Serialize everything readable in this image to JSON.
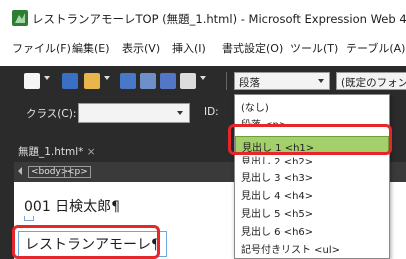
{
  "window": {
    "title": "レストランアモーレTOP (無題_1.html) - Microsoft Expression Web 4"
  },
  "menu": {
    "items": [
      "ファイル(F)",
      "編集(E)",
      "表示(V)",
      "挿入(I)",
      "書式設定(O)",
      "ツール(T)",
      "テーブル(A)"
    ]
  },
  "toolbar": {
    "style_select_value": "段落",
    "font_select_value": "(既定のフォン",
    "class_label": "クラス(C):",
    "id_label": "ID:"
  },
  "editor": {
    "tab_label": "無題_1.html*",
    "tab_close": "×",
    "tag_path": [
      "<body>",
      "<p>"
    ],
    "line1": "001 日検太郎¶",
    "line2": "レストランアモーレ¶"
  },
  "style_dropdown": {
    "options": [
      "(なし)",
      "段落 <p>",
      "見出し 1 <h1>",
      "見出し 2 <h2>",
      "見出し 3 <h3>",
      "見出し 4 <h4>",
      "見出し 5 <h5>",
      "見出し 6 <h6>",
      "記号付きリスト <ul>"
    ],
    "highlighted": "見出し 1 <h1>"
  },
  "colors": {
    "highlight_green": "#a3d06b",
    "callout_red": "#e5262b",
    "toolbar_dark": "#2b2b2b"
  }
}
